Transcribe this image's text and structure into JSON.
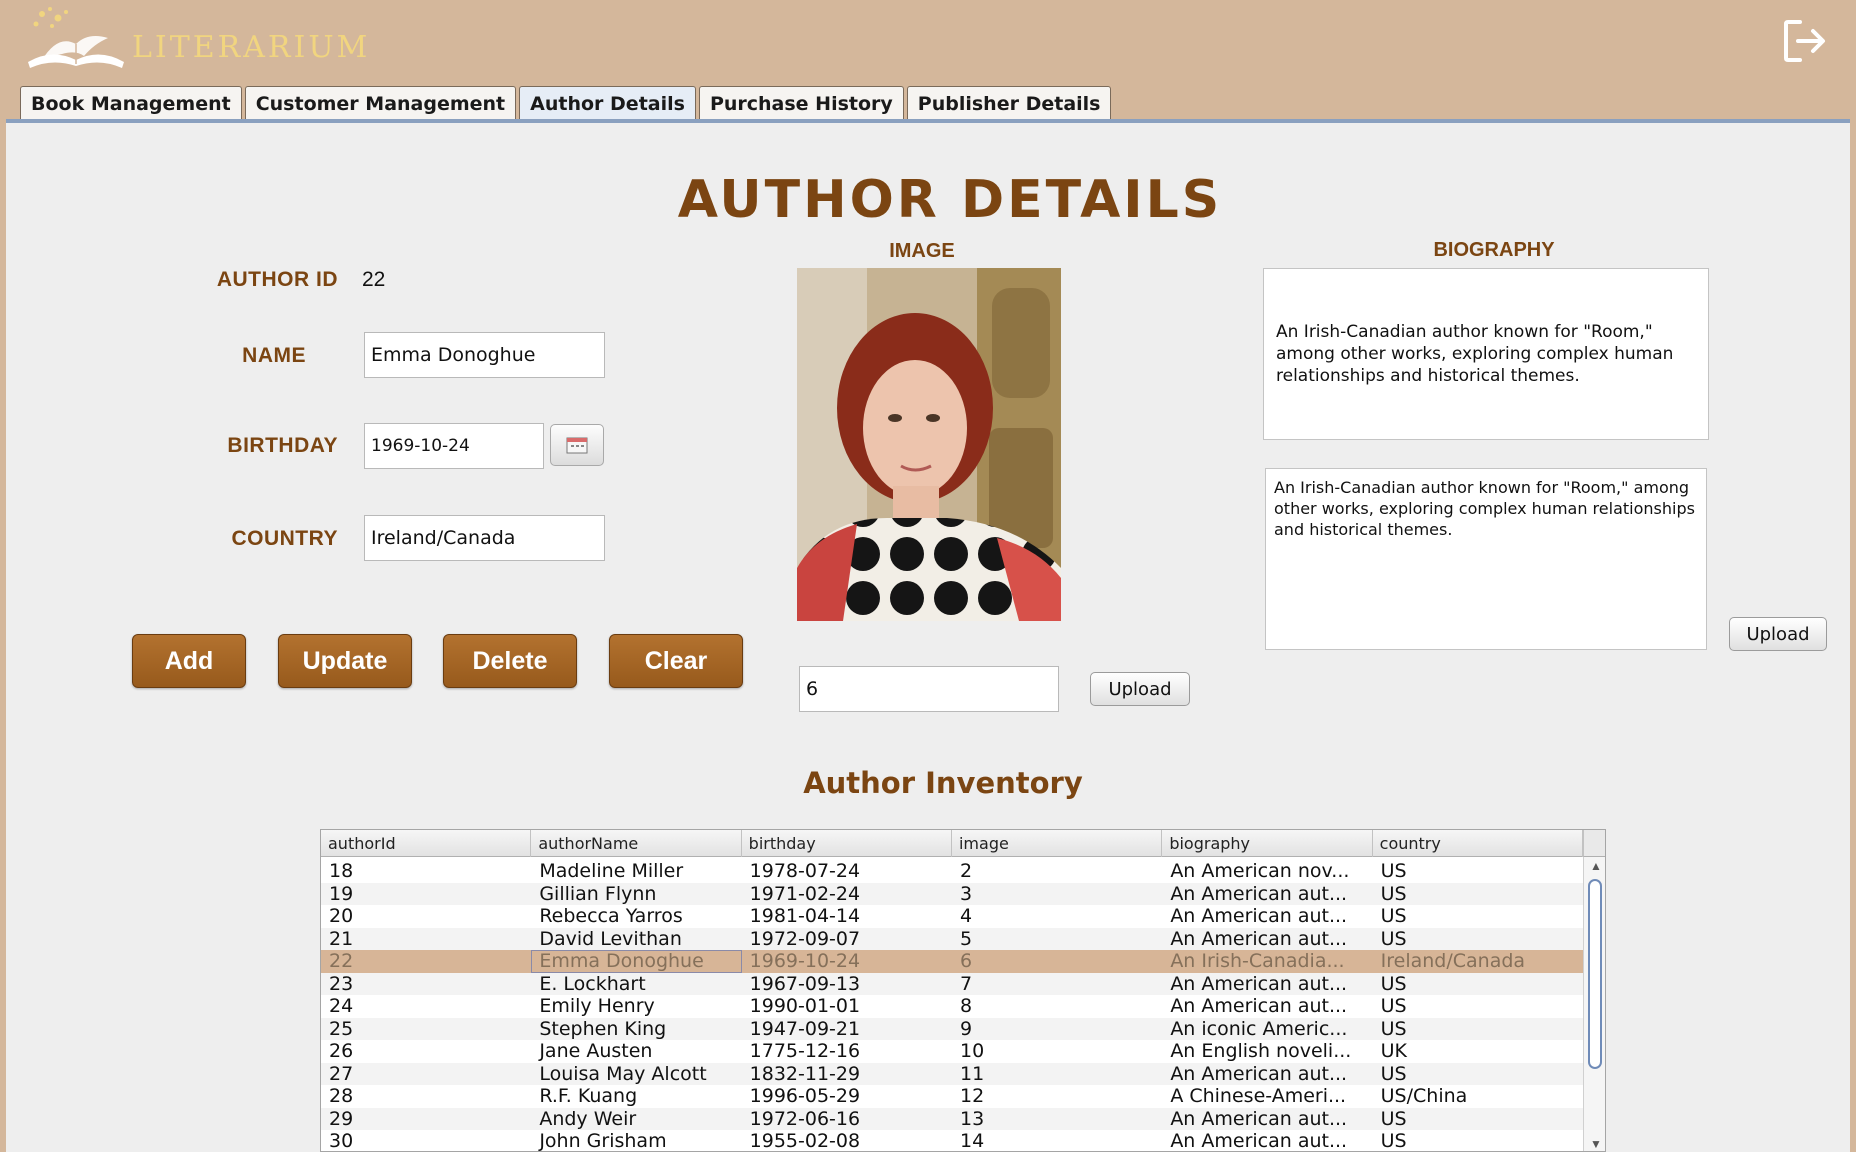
{
  "app": {
    "logo_text": "LITERARIUM",
    "logout_icon": "logout-icon"
  },
  "tabs": [
    {
      "label": "Book Management"
    },
    {
      "label": "Customer Management"
    },
    {
      "label": "Author Details"
    },
    {
      "label": "Purchase History"
    },
    {
      "label": "Publisher Details"
    }
  ],
  "page": {
    "title": "AUTHOR DETAILS"
  },
  "form": {
    "author_id_label": "AUTHOR ID",
    "author_id_value": "22",
    "name_label": "NAME",
    "name_value": "Emma Donoghue",
    "birthday_label": "BIRTHDAY",
    "birthday_value": "1969-10-24",
    "country_label": "COUNTRY",
    "country_value": "Ireland/Canada"
  },
  "buttons": {
    "add": "Add",
    "update": "Update",
    "delete": "Delete",
    "clear": "Clear"
  },
  "image_section": {
    "label": "IMAGE",
    "image_field_value": "6",
    "upload_label": "Upload"
  },
  "biography_section": {
    "label": "BIOGRAPHY",
    "display_text": "An Irish-Canadian author known for \"Room,\" among other works, exploring complex human relationships and historical themes.",
    "edit_text": "An Irish-Canadian author known for \"Room,\" among other works, exploring complex human relationships and historical themes.",
    "upload_label": "Upload"
  },
  "inventory": {
    "title": "Author Inventory",
    "columns": [
      "authorId",
      "authorName",
      "birthday",
      "image",
      "biography",
      "country"
    ],
    "rows": [
      [
        "18",
        "Madeline Miller",
        "1978-07-24",
        "2",
        "An American nov...",
        "US"
      ],
      [
        "19",
        "Gillian Flynn",
        "1971-02-24",
        "3",
        "An American aut...",
        "US"
      ],
      [
        "20",
        "Rebecca Yarros",
        "1981-04-14",
        "4",
        "An American aut...",
        "US"
      ],
      [
        "21",
        "David Levithan",
        "1972-09-07",
        "5",
        "An American aut...",
        "US"
      ],
      [
        "22",
        "Emma Donoghue",
        "1969-10-24",
        "6",
        "An Irish-Canadia...",
        "Ireland/Canada"
      ],
      [
        "23",
        "E. Lockhart",
        "1967-09-13",
        "7",
        "An American aut...",
        "US"
      ],
      [
        "24",
        "Emily Henry",
        "1990-01-01",
        "8",
        "An American aut...",
        "US"
      ],
      [
        "25",
        "Stephen King",
        "1947-09-21",
        "9",
        "An iconic Americ...",
        "US"
      ],
      [
        "26",
        "Jane Austen",
        "1775-12-16",
        "10",
        "An English noveli...",
        "UK"
      ],
      [
        "27",
        "Louisa May Alcott",
        "1832-11-29",
        "11",
        "An American aut...",
        "US"
      ],
      [
        "28",
        "R.F. Kuang",
        "1996-05-29",
        "12",
        "A Chinese-Ameri...",
        "US/China"
      ],
      [
        "29",
        "Andy Weir",
        "1972-06-16",
        "13",
        "An American aut...",
        "US"
      ],
      [
        "30",
        "John Grisham",
        "1955-02-08",
        "14",
        "An American aut...",
        "US"
      ]
    ],
    "selected_row": 4
  },
  "colors": {
    "background": "#d4b79b",
    "accent_brown": "#7b4512",
    "button_brown": "#a8672a",
    "selected_row": "#d7b597",
    "logo_gold": "#f1d57f"
  }
}
